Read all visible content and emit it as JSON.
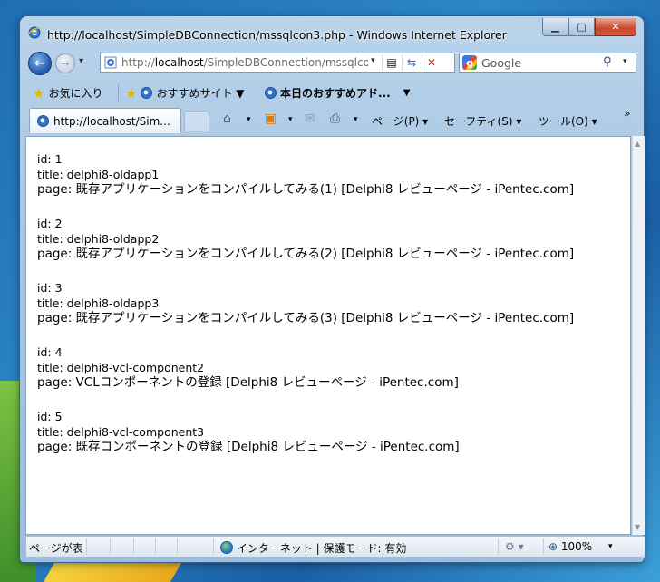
{
  "window": {
    "title": "http://localhost/SimpleDBConnection/mssqlcon3.php - Windows Internet Explorer"
  },
  "address": {
    "prefix": "http://",
    "host": "localhost",
    "path": "/SimpleDBConnection/mssqlco"
  },
  "search": {
    "placeholder": "Google"
  },
  "favorites_bar": {
    "favorites_label": "お気に入り",
    "items": [
      {
        "label": "おすすめサイト ▼"
      },
      {
        "label": "本日のおすすめアド..."
      }
    ]
  },
  "tabs": [
    {
      "label": "http://localhost/Sim..."
    }
  ],
  "command_bar": {
    "page_label": "ページ(P) ▾",
    "safety_label": "セーフティ(S) ▾",
    "tools_label": "ツール(O) ▾"
  },
  "records": [
    {
      "id": "id: 1",
      "title": "title: delphi8-oldapp1",
      "page": "page: 既存アプリケーションをコンパイルしてみる(1) [Delphi8 レビューページ - iPentec.com]"
    },
    {
      "id": "id: 2",
      "title": "title: delphi8-oldapp2",
      "page": "page: 既存アプリケーションをコンパイルしてみる(2) [Delphi8 レビューページ - iPentec.com]"
    },
    {
      "id": "id: 3",
      "title": "title: delphi8-oldapp3",
      "page": "page: 既存アプリケーションをコンパイルしてみる(3) [Delphi8 レビューページ - iPentec.com]"
    },
    {
      "id": "id: 4",
      "title": "title: delphi8-vcl-component2",
      "page": "page: VCLコンポーネントの登録 [Delphi8 レビューページ - iPentec.com]"
    },
    {
      "id": "id: 5",
      "title": "title: delphi8-vcl-component3",
      "page": "page: 既存コンポーネントの登録 [Delphi8 レビューページ - iPentec.com]"
    }
  ],
  "status": {
    "left_text": "ページが表",
    "zone_text": "インターネット | 保護モード: 有効",
    "zoom": "100%"
  }
}
